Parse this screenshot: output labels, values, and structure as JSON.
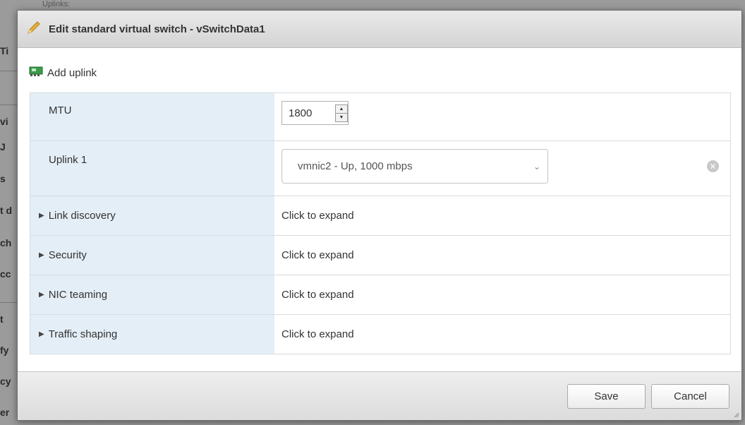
{
  "background": {
    "fragments": [
      "Ti",
      "vi",
      "J",
      "s",
      "t d",
      "ch",
      "cc",
      "t",
      "fy",
      "cy",
      "er"
    ],
    "top_fragment": "Uplinks:"
  },
  "dialog": {
    "title": "Edit standard virtual switch - vSwitchData1",
    "toolbar": {
      "add_uplink_label": "Add uplink",
      "icon": "network-card-icon"
    },
    "mtu": {
      "label": "MTU",
      "value": "1800"
    },
    "uplink": {
      "label": "Uplink 1",
      "selected": "vmnic2 - Up, 1000 mbps"
    },
    "sections": [
      {
        "label": "Link discovery",
        "value": "Click to expand"
      },
      {
        "label": "Security",
        "value": "Click to expand"
      },
      {
        "label": "NIC teaming",
        "value": "Click to expand"
      },
      {
        "label": "Traffic shaping",
        "value": "Click to expand"
      }
    ],
    "footer": {
      "save_label": "Save",
      "cancel_label": "Cancel"
    }
  },
  "colors": {
    "label_column": "#e4eef6",
    "accent_pencil": "#e0a020",
    "icon_green": "#2e8b3a"
  }
}
